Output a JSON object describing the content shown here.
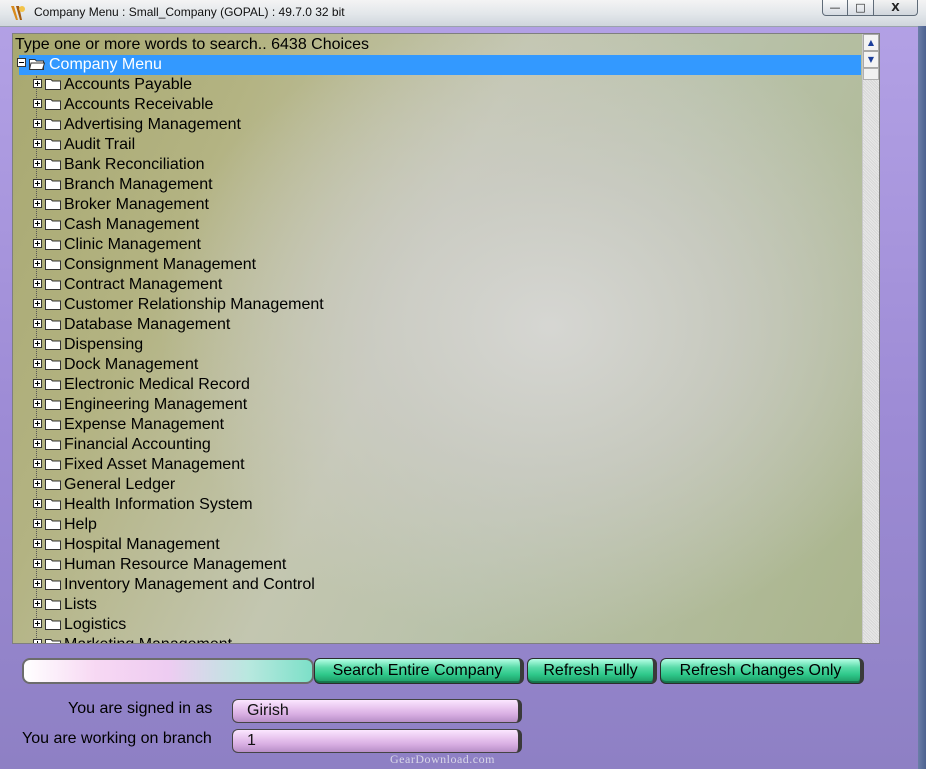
{
  "window": {
    "title": "Company Menu : Small_Company (GOPAL) :  49.7.0 32 bit",
    "controls": {
      "minimize": "—",
      "maximize": "□",
      "close": "X"
    }
  },
  "tree": {
    "search_hint": "Type one or more words to search.. 6438 Choices",
    "root_label": "Company Menu",
    "items": [
      "Accounts Payable",
      "Accounts Receivable",
      "Advertising Management",
      "Audit Trail",
      "Bank Reconciliation",
      "Branch Management",
      "Broker Management",
      "Cash Management",
      "Clinic Management",
      "Consignment Management",
      "Contract Management",
      "Customer Relationship Management",
      "Database Management",
      "Dispensing",
      "Dock Management",
      "Electronic Medical Record",
      "Engineering Management",
      "Expense Management",
      "Financial Accounting",
      "Fixed Asset Management",
      "General Ledger",
      "Health Information System",
      "Help",
      "Hospital Management",
      "Human Resource Management",
      "Inventory Management and Control",
      "Lists",
      "Logistics",
      "Marketing Management"
    ]
  },
  "toolbar": {
    "search_value": "",
    "search_entire_label": "Search Entire Company",
    "refresh_fully_label": "Refresh Fully",
    "refresh_changes_label": "Refresh Changes Only"
  },
  "status": {
    "signed_in_label": "You are signed in as",
    "signed_in_value": "Girish",
    "branch_label": "You are working on branch",
    "branch_value": "1"
  },
  "watermark": "GearDownload.com",
  "colors": {
    "selection": "#3399ff",
    "window_bg": "#a595dc",
    "button_green": "#2ec88a"
  }
}
